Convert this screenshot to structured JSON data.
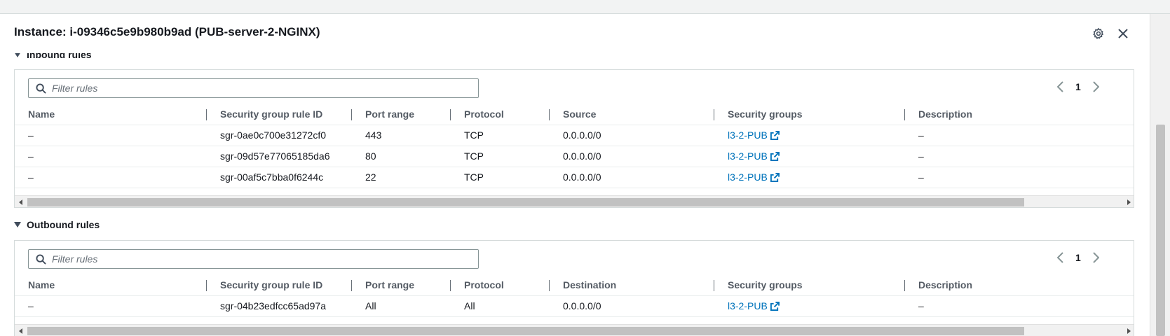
{
  "panel": {
    "title": "Instance: i-09346c5e9b980b9ad (PUB-server-2-NGINX)"
  },
  "inbound": {
    "heading": "Inbound rules",
    "filter_placeholder": "Filter rules",
    "page": "1",
    "columns": [
      "Name",
      "Security group rule ID",
      "Port range",
      "Protocol",
      "Source",
      "Security groups",
      "Description"
    ],
    "rows": [
      {
        "name": "–",
        "rule_id": "sgr-0ae0c700e31272cf0",
        "port": "443",
        "protocol": "TCP",
        "source": "0.0.0.0/0",
        "group": "l3-2-PUB",
        "description": "–"
      },
      {
        "name": "–",
        "rule_id": "sgr-09d57e77065185da6",
        "port": "80",
        "protocol": "TCP",
        "source": "0.0.0.0/0",
        "group": "l3-2-PUB",
        "description": "–"
      },
      {
        "name": "–",
        "rule_id": "sgr-00af5c7bba0f6244c",
        "port": "22",
        "protocol": "TCP",
        "source": "0.0.0.0/0",
        "group": "l3-2-PUB",
        "description": "–"
      }
    ]
  },
  "outbound": {
    "heading": "Outbound rules",
    "filter_placeholder": "Filter rules",
    "page": "1",
    "columns": [
      "Name",
      "Security group rule ID",
      "Port range",
      "Protocol",
      "Destination",
      "Security groups",
      "Description"
    ],
    "rows": [
      {
        "name": "–",
        "rule_id": "sgr-04b23edfcc65ad97a",
        "port": "All",
        "protocol": "All",
        "source": "0.0.0.0/0",
        "group": "l3-2-PUB",
        "description": "–"
      }
    ]
  },
  "icons": {
    "gear": "gear-icon",
    "close": "close-icon",
    "search": "search-icon",
    "external": "external-link-icon"
  },
  "colors": {
    "link": "#0073bb",
    "text": "#16191f",
    "header_text": "#545b64",
    "border": "#d5dbdb"
  }
}
